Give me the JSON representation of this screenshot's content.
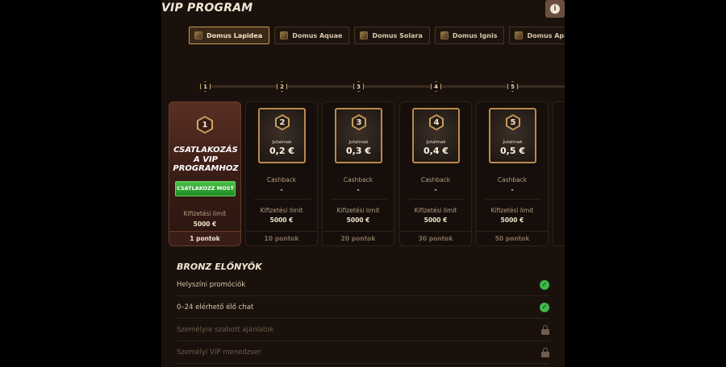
{
  "header": {
    "title": "VIP PROGRAM",
    "info_icon": "info-icon"
  },
  "tabs": [
    {
      "label": "Domus Lapidea",
      "active": true
    },
    {
      "label": "Domus Aquae",
      "active": false
    },
    {
      "label": "Domus Solara",
      "active": false
    },
    {
      "label": "Domus Ignis",
      "active": false
    },
    {
      "label": "Domus Apis",
      "active": false
    }
  ],
  "steps": [
    "1",
    "2",
    "3",
    "4",
    "5"
  ],
  "current_level": {
    "number": "1",
    "title": "CSATLAKOZÁS A VIP PROGRAMHOZ",
    "button": "CSATLAKOZZ MOST",
    "payout_label": "Kifizetési limit",
    "payout_value": "5000 €",
    "points": "1 pontok"
  },
  "levels": [
    {
      "number": "2",
      "reward_label": "Jutalmak",
      "reward": "0,2 €",
      "cashback_label": "Cashback",
      "cashback": "-",
      "payout_label": "Kifizetési limit",
      "payout_value": "5000 €",
      "points": "10 pontok"
    },
    {
      "number": "3",
      "reward_label": "Jutalmak",
      "reward": "0,3 €",
      "cashback_label": "Cashback",
      "cashback": "-",
      "payout_label": "Kifizetési limit",
      "payout_value": "5000 €",
      "points": "20 pontok"
    },
    {
      "number": "4",
      "reward_label": "Jutalmak",
      "reward": "0,4 €",
      "cashback_label": "Cashback",
      "cashback": "-",
      "payout_label": "Kifizetési limit",
      "payout_value": "5000 €",
      "points": "30 pontok"
    },
    {
      "number": "5",
      "reward_label": "Jutalmak",
      "reward": "0,5 €",
      "cashback_label": "Cashback",
      "cashback": "-",
      "payout_label": "Kifizetési limit",
      "payout_value": "5000 €",
      "points": "50 pontok"
    }
  ],
  "benefits": {
    "title": "BRONZ ELŐNYÖK",
    "items": [
      {
        "label": "Helyszíni promóciók",
        "unlocked": true
      },
      {
        "label": "0–24 elérhető élő chat",
        "unlocked": true
      },
      {
        "label": "Személyre szabott ajánlatok",
        "unlocked": false
      },
      {
        "label": "Személyi VIP menedzser",
        "unlocked": false
      }
    ]
  },
  "colors": {
    "accent_gold": "#c79a52",
    "join_green": "#2fa83a",
    "check_green": "#3fb54a"
  }
}
